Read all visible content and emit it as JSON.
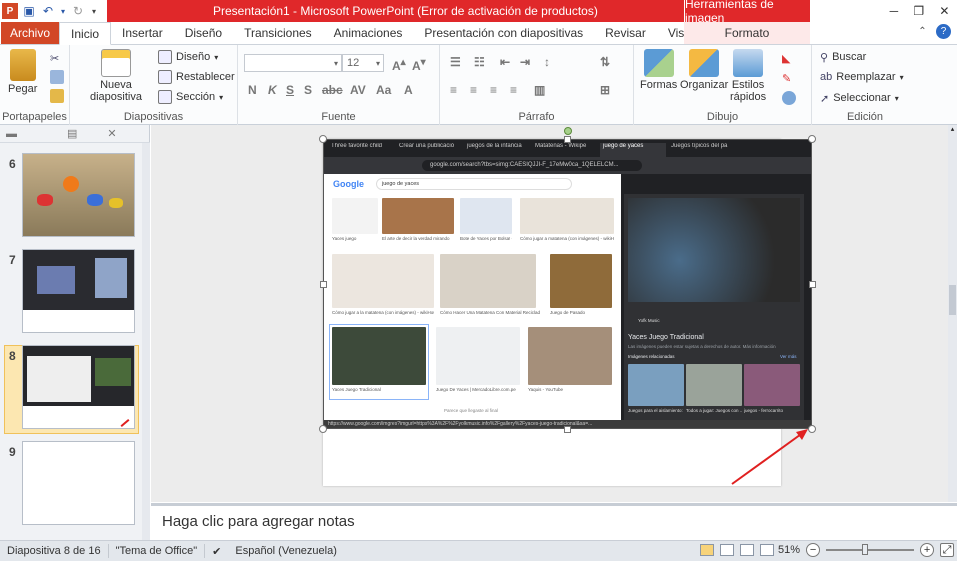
{
  "window": {
    "title": "Presentación1  -  Microsoft PowerPoint (Error de activación de productos)",
    "context_group": "Herramientas de imagen",
    "app_icon": "P"
  },
  "tabs": [
    "Archivo",
    "Inicio",
    "Insertar",
    "Diseño",
    "Transiciones",
    "Animaciones",
    "Presentación con diapositivas",
    "Revisar",
    "Vista"
  ],
  "context_tab": "Formato",
  "ribbon": {
    "portapapeles": {
      "label": "Portapapeles",
      "paste": "Pegar"
    },
    "diapositivas": {
      "label": "Diapositivas",
      "new_slide_1": "Nueva",
      "new_slide_2": "diapositiva",
      "layout": "Diseño",
      "reset": "Restablecer",
      "section": "Sección"
    },
    "fuente": {
      "label": "Fuente",
      "font_size": "12"
    },
    "parrafo": {
      "label": "Párrafo"
    },
    "dibujo": {
      "label": "Dibujo",
      "shapes": "Formas",
      "arrange": "Organizar",
      "styles_1": "Estilos",
      "styles_2": "rápidos"
    },
    "edicion": {
      "label": "Edición",
      "find": "Buscar",
      "replace": "Reemplazar",
      "select": "Seleccionar"
    }
  },
  "slides": [
    {
      "num": "6"
    },
    {
      "num": "7"
    },
    {
      "num": "8"
    },
    {
      "num": "9"
    }
  ],
  "browser": {
    "tabs": [
      "Three favorite child",
      "Crear una publicació",
      "juegos de la infancia",
      "Matatenas - Wikipe",
      "juego de yaces",
      "Juegos típicos del pa"
    ],
    "url": "google.com/search?tbs=simg:CAESIQJJI-F_17eMw0ca_1QELELCM...",
    "google": "Google",
    "query": "juego de yaces",
    "captions": [
      "Yaces juego",
      "El arte de decir la verdad mirando",
      "Bote de Yaces por Bolsa! G",
      "Cómo jugar a matatena (con imágenes) - wikiHow",
      "Cómo jugar a la matatena (con imágenes) - wikiHow",
      "Cómo Hacer Una Matatena Con Material Reciclado - G",
      "Juego de Pasado",
      "Yaces Juego Tradicional",
      "Juego De Yaces | MercadoLibre.com.pe",
      "Yaquis - YouTube"
    ],
    "end_note": "Parece que llegaste al final",
    "panel_source": "Yofk Music",
    "panel_title": "Yaces Juego Tradicional",
    "panel_sub": "Las imágenes pueden estar sujetas a derechos de autor. Más información",
    "related": "Imágenes relacionadas",
    "see_more": "Ver más",
    "related_caps": [
      "Juegos para el aislamiento:",
      "Todos a jugar: Juegos con ...",
      "juegos - ferrocarrito"
    ],
    "status_url": "https://www.google.com/imgres?imgurl=https%3A%2F%2Fyolkmusic.info%2Fgallery%2Fyaces-juego-tradicional&sa=..."
  },
  "notes_placeholder": "Haga clic para agregar notas",
  "status": {
    "slide_info": "Diapositiva 8 de 16",
    "theme": "\"Tema de Office\"",
    "language": "Español (Venezuela)",
    "zoom": "51%"
  },
  "colors": {
    "accent": "#d24726",
    "title_band": "#e0282a",
    "selection": "#fce7b1",
    "arrow": "#e02020"
  }
}
